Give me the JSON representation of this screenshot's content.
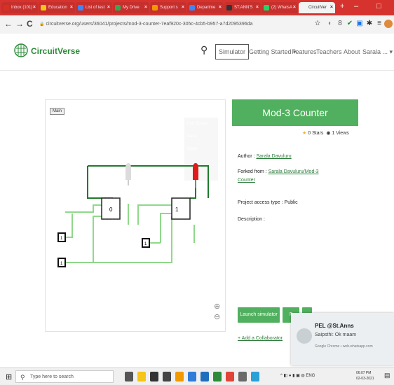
{
  "browser": {
    "tabs": [
      {
        "label": "Inbox (101)",
        "fav": "#d93025"
      },
      {
        "label": "Education",
        "fav": "#f5c518"
      },
      {
        "label": "List of test",
        "fav": "#4285f4"
      },
      {
        "label": "My Drive",
        "fav": "#34a853"
      },
      {
        "label": "Support s",
        "fav": "#f29900"
      },
      {
        "label": "Departme",
        "fav": "#4285f4"
      },
      {
        "label": "ST.ANN'S",
        "fav": "#333333"
      },
      {
        "label": "(2) WhatsA",
        "fav": "#25d366"
      },
      {
        "label": "CircuitVer",
        "fav": "#f3f3f3"
      }
    ],
    "new_tab": "+",
    "min": "–",
    "max": "□",
    "url": "circuitverse.org/users/36041/projects/mod-3-counter-7eaf920c-305c-4cb5-b957-a7d2095396da",
    "back": "←",
    "forward": "→",
    "reload": "C",
    "lock": "🔒",
    "ext_icons": [
      "☆",
      "◐",
      "8",
      "✔",
      "▣",
      "✱",
      "≡"
    ]
  },
  "site": {
    "brand": "CircuitVerse",
    "nav": {
      "simulator": "Simulator",
      "getting_started": "Getting Started ▾",
      "features": "Features",
      "teachers": "Teachers",
      "about": "About",
      "user": "Sarala ... ▾"
    },
    "search_icon": "⚲"
  },
  "canvas": {
    "main_tab": "Main",
    "ghost_fullscreen": "Full Screen",
    "ghost_save": "Save",
    "ghost_clear": "Clear",
    "ff_labels": [
      "0",
      "1"
    ],
    "input_labels": [
      "1",
      "1",
      "1"
    ],
    "zoom_in": "⊕",
    "zoom_out": "⊖"
  },
  "project": {
    "title": "Mod-3 Counter",
    "stars": "0 Stars",
    "views": "1 Views",
    "author_label": "Author :",
    "author": "Sarala Davuluru",
    "forked_label": "Forked from :",
    "forked_line1": "Sarala Davuluru/Mod-3",
    "forked_line2": "Counter",
    "access": "Project access type : Public",
    "description": "Description :",
    "launch": "Launch simulator",
    "fork": "F",
    "add_collab": "+ Add a Collaborator"
  },
  "toast": {
    "title": "PEL @St.Anns",
    "message": "Saipsthi: Ok maam",
    "source": "Google Chrome • web.whatsapp.com"
  },
  "taskbar": {
    "start": "⊞",
    "search_placeholder": "Type here to search",
    "app_colors": [
      "#555555",
      "#f5c518",
      "#333333",
      "#444444",
      "#f29900",
      "#2f7bd8",
      "#1f6fbd",
      "#2c8b3a",
      "#e0453a",
      "#6a6a6a",
      "#2aa0d8"
    ],
    "tray_text": "^ ◧ ● ▮ ▣ ◍ ENG",
    "time": "06:07 PM",
    "date": "02-03-2021"
  },
  "colors": {
    "accent": "#51b05f",
    "tab_red": "#d6332f",
    "brand_green": "#2c8b3a"
  }
}
